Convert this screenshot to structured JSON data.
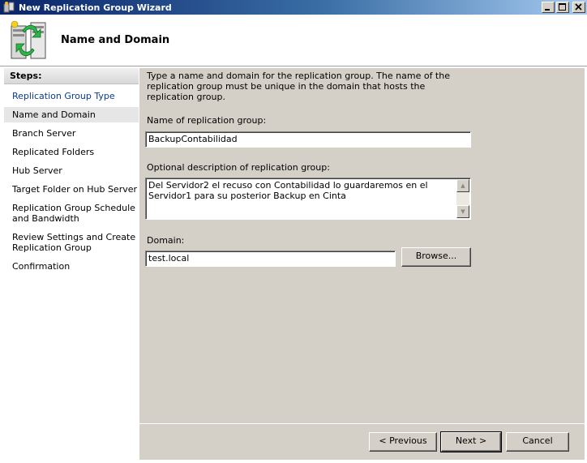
{
  "window": {
    "title": "New Replication Group Wizard",
    "controls": [
      "minimize-icon",
      "maximize-icon",
      "close-icon"
    ]
  },
  "header": {
    "title": "Name and Domain",
    "icon": "replication-servers-icon"
  },
  "steps": {
    "heading": "Steps:",
    "items": [
      {
        "label": "Replication Group Type",
        "state": "link"
      },
      {
        "label": "Name and Domain",
        "state": "active"
      },
      {
        "label": "Branch Server",
        "state": "normal"
      },
      {
        "label": "Replicated Folders",
        "state": "normal"
      },
      {
        "label": "Hub Server",
        "state": "normal"
      },
      {
        "label": "Target Folder on Hub Server",
        "state": "normal"
      },
      {
        "label": "Replication Group Schedule and Bandwidth",
        "state": "normal"
      },
      {
        "label": "Review Settings and Create Replication Group",
        "state": "normal"
      },
      {
        "label": "Confirmation",
        "state": "normal"
      }
    ]
  },
  "form": {
    "intro": "Type a name and domain for the replication group. The name of the replication group must be unique in the domain that hosts the replication group.",
    "name_label": "Name of replication group:",
    "name_value": "BackupContabilidad",
    "description_label": "Optional description of replication group:",
    "description_value": "Del Servidor2 el recuso con Contabilidad lo guardaremos en el Servidor1 para su posterior Backup en Cinta",
    "domain_label": "Domain:",
    "domain_value": "test.local",
    "browse_label": "Browse..."
  },
  "buttons": {
    "previous": "< Previous",
    "next": "Next >",
    "cancel": "Cancel"
  },
  "colors": {
    "titlebar_start": "#0a246a",
    "titlebar_end": "#a6caf0",
    "dialog_face": "#d4d0c8",
    "link": "#0b3a8a"
  }
}
